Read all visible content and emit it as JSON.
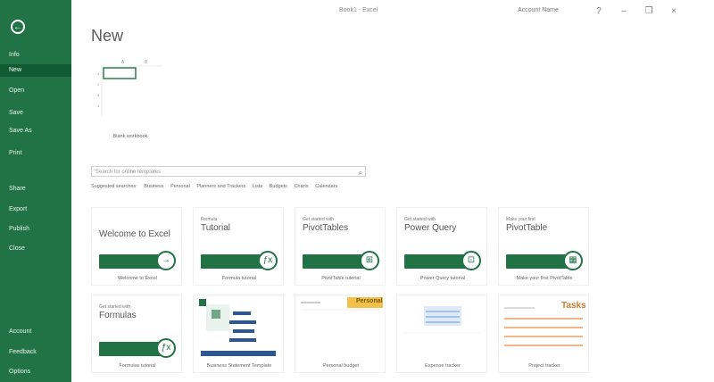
{
  "titlebar": {
    "app_title": "Book1 - Excel"
  },
  "account": {
    "name": "Account Name",
    "help": "?"
  },
  "window": {
    "minimize": "–",
    "restore": "❐",
    "close": "×"
  },
  "page": {
    "title": "New"
  },
  "sidebar": {
    "items": [
      {
        "label": "Info"
      },
      {
        "label": "New"
      },
      {
        "label": "Open"
      },
      {
        "label": "Save"
      },
      {
        "label": "Save As"
      },
      {
        "label": "Print"
      },
      {
        "label": "Share"
      },
      {
        "label": "Export"
      },
      {
        "label": "Publish"
      },
      {
        "label": "Close"
      },
      {
        "label": "Account"
      },
      {
        "label": "Feedback"
      },
      {
        "label": "Options"
      }
    ]
  },
  "blank": {
    "caption": "Blank workbook"
  },
  "search": {
    "placeholder": "Search for online templates"
  },
  "suggestions": {
    "label": "Suggested searches:",
    "items": [
      "Business",
      "Personal",
      "Planners and Trackers",
      "Lists",
      "Budgets",
      "Charts",
      "Calendars"
    ]
  },
  "templates": [
    {
      "sub": "",
      "title": "Welcome to Excel",
      "caption": "Welcome to Excel"
    },
    {
      "sub": "Formula",
      "title": "Tutorial",
      "caption": "Formula tutorial"
    },
    {
      "sub": "Get started with",
      "title": "PivotTables",
      "caption": "PivotTable tutorial"
    },
    {
      "sub": "Get started with",
      "title": "Power Query",
      "caption": "Power Query tutorial"
    },
    {
      "sub": "Make your first",
      "title": "PivotTable",
      "caption": "Make your first PivotTable"
    },
    {
      "sub": "Get started with",
      "title": "Formulas",
      "caption": "Formulas tutorial"
    },
    {
      "sub": "",
      "title": "",
      "caption": "Business Statement Template"
    },
    {
      "sub": "",
      "title": "Personal",
      "caption": "Personal budget"
    },
    {
      "sub": "",
      "title": "",
      "caption": "Expense tracker"
    },
    {
      "sub": "",
      "title": "Tasks",
      "caption": "Project tracker"
    }
  ]
}
